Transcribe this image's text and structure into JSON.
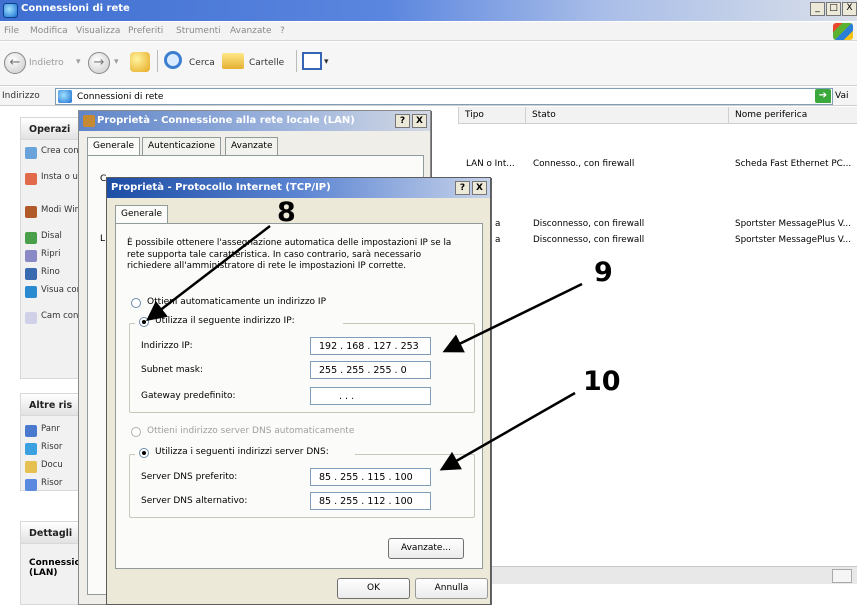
{
  "explorer": {
    "title": "Connessioni di rete",
    "window_buttons": [
      "_",
      "□",
      "X"
    ],
    "menu": [
      "File",
      "Modifica",
      "Visualizza",
      "Preferiti",
      "Strumenti",
      "Avanzate",
      "?"
    ],
    "toolbar": {
      "back": "Indietro",
      "search": "Cerca",
      "folders": "Cartelle"
    },
    "address": {
      "label": "Indirizzo",
      "value": "Connessioni di rete",
      "go": "Vai"
    },
    "tasks": {
      "box1_title": "Operazi",
      "box1_items": [
        "Crea conn",
        "Insta o un azien",
        "Modi Wind",
        "Disal",
        "Ripri",
        "Rino",
        "Visua conn",
        "Cam conn"
      ],
      "box2_title": "Altre ris",
      "box2_items": [
        "Panr",
        "Risor",
        "Docu",
        "Risor"
      ],
      "box3_title": "Dettagli",
      "box3_text": "Connessione (LAN)"
    },
    "columns": [
      "Tipo",
      "Stato",
      "Nome periferica"
    ],
    "rows": [
      {
        "tipo": "LAN o Int...",
        "stato": "Connesso., con firewall",
        "nome": "Scheda Fast Ethernet PC..."
      },
      {
        "tipo": "a",
        "stato": "Disconnesso, con firewall",
        "nome": "Sportster MessagePlus V..."
      },
      {
        "tipo": "a",
        "stato": "Disconnesso, con firewall",
        "nome": "Sportster MessagePlus V..."
      }
    ]
  },
  "lan_dialog": {
    "title": "Proprietà - Connessione alla rete locale (LAN)",
    "help": "?",
    "close": "X",
    "tabs": [
      "Generale",
      "Autenticazione",
      "Avanzate"
    ],
    "partial_label": "C",
    "partial_label2": "L"
  },
  "tcp_dialog": {
    "title": "Proprietà - Protocollo Internet (TCP/IP)",
    "help": "?",
    "close": "X",
    "tab": "Generale",
    "description": "È possibile ottenere l'assegnazione automatica delle impostazioni IP se la rete supporta tale caratteristica. In caso contrario, sarà necessario richiedere all'amministratore di rete le impostazioni IP corrette.",
    "radio_auto_ip": "Ottieni automaticamente un indirizzo IP",
    "radio_manual_ip": "Utilizza il seguente indirizzo IP:",
    "ip_label": "Indirizzo IP:",
    "ip_value": "192 . 168 . 127 . 253",
    "mask_label": "Subnet mask:",
    "mask_value": "255 . 255 . 255 .  0",
    "gateway_label": "Gateway predefinito:",
    "gateway_value": ".    .    .",
    "radio_auto_dns": "Ottieni indirizzo server DNS automaticamente",
    "radio_manual_dns": "Utilizza i seguenti indirizzi server DNS:",
    "dns1_label": "Server DNS preferito:",
    "dns1_value": "85 . 255 . 115 . 100",
    "dns2_label": "Server DNS alternativo:",
    "dns2_value": "85 . 255 . 112 . 100",
    "advanced_button": "Avanzate...",
    "ok_button": "OK",
    "cancel_button": "Annulla"
  },
  "annotations": [
    "8",
    "9",
    "10"
  ]
}
